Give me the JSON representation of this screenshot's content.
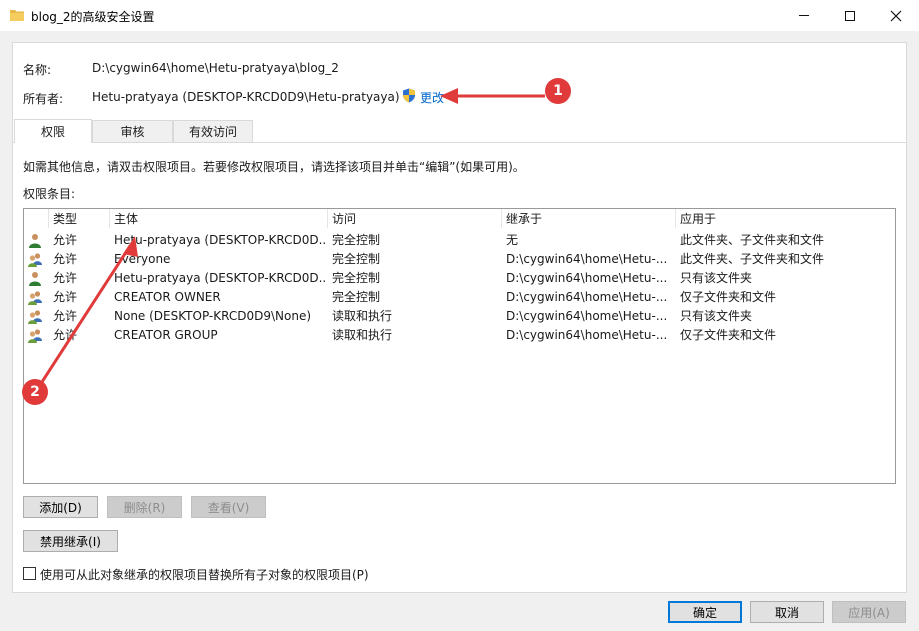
{
  "window": {
    "title": "blog_2的高级安全设置",
    "minimize": "—",
    "maximize": "□",
    "close": "✕"
  },
  "info": {
    "name_label": "名称:",
    "name_value": "D:\\cygwin64\\home\\Hetu-pratyaya\\blog_2",
    "owner_label": "所有者:",
    "owner_value": "Hetu-pratyaya (DESKTOP-KRCD0D9\\Hetu-pratyaya)",
    "change_link": "更改"
  },
  "tabs": [
    {
      "label": "权限",
      "active": true
    },
    {
      "label": "审核",
      "active": false
    },
    {
      "label": "有效访问",
      "active": false
    }
  ],
  "instructions": "如需其他信息，请双击权限项目。若要修改权限项目，请选择该项目并单击“编辑”(如果可用)。",
  "entries_label": "权限条目:",
  "columns": [
    "类型",
    "主体",
    "访问",
    "继承于",
    "应用于"
  ],
  "rows": [
    {
      "icon": "user-icon",
      "type": "允许",
      "principal": "Hetu-pratyaya (DESKTOP-KRCD0D...",
      "access": "完全控制",
      "inherited": "无",
      "applies": "此文件夹、子文件夹和文件"
    },
    {
      "icon": "group-icon",
      "type": "允许",
      "principal": "Everyone",
      "access": "完全控制",
      "inherited": "D:\\cygwin64\\home\\Hetu-...",
      "applies": "此文件夹、子文件夹和文件"
    },
    {
      "icon": "user-icon",
      "type": "允许",
      "principal": "Hetu-pratyaya (DESKTOP-KRCD0D...",
      "access": "完全控制",
      "inherited": "D:\\cygwin64\\home\\Hetu-...",
      "applies": "只有该文件夹"
    },
    {
      "icon": "group-icon",
      "type": "允许",
      "principal": "CREATOR OWNER",
      "access": "完全控制",
      "inherited": "D:\\cygwin64\\home\\Hetu-...",
      "applies": "仅子文件夹和文件"
    },
    {
      "icon": "group-icon",
      "type": "允许",
      "principal": "None (DESKTOP-KRCD0D9\\None)",
      "access": "读取和执行",
      "inherited": "D:\\cygwin64\\home\\Hetu-...",
      "applies": "只有该文件夹"
    },
    {
      "icon": "group-icon",
      "type": "允许",
      "principal": "CREATOR GROUP",
      "access": "读取和执行",
      "inherited": "D:\\cygwin64\\home\\Hetu-...",
      "applies": "仅子文件夹和文件"
    }
  ],
  "buttons": {
    "add": "添加(D)",
    "remove": "删除(R)",
    "view": "查看(V)",
    "disable_inheritance": "禁用继承(I)",
    "ok": "确定",
    "cancel": "取消",
    "apply": "应用(A)"
  },
  "replace_checkbox": "使用可从此对象继承的权限项目替换所有子对象的权限项目(P)",
  "annotations": {
    "badge1": "1",
    "badge2": "2",
    "color": "#e03a3a"
  }
}
